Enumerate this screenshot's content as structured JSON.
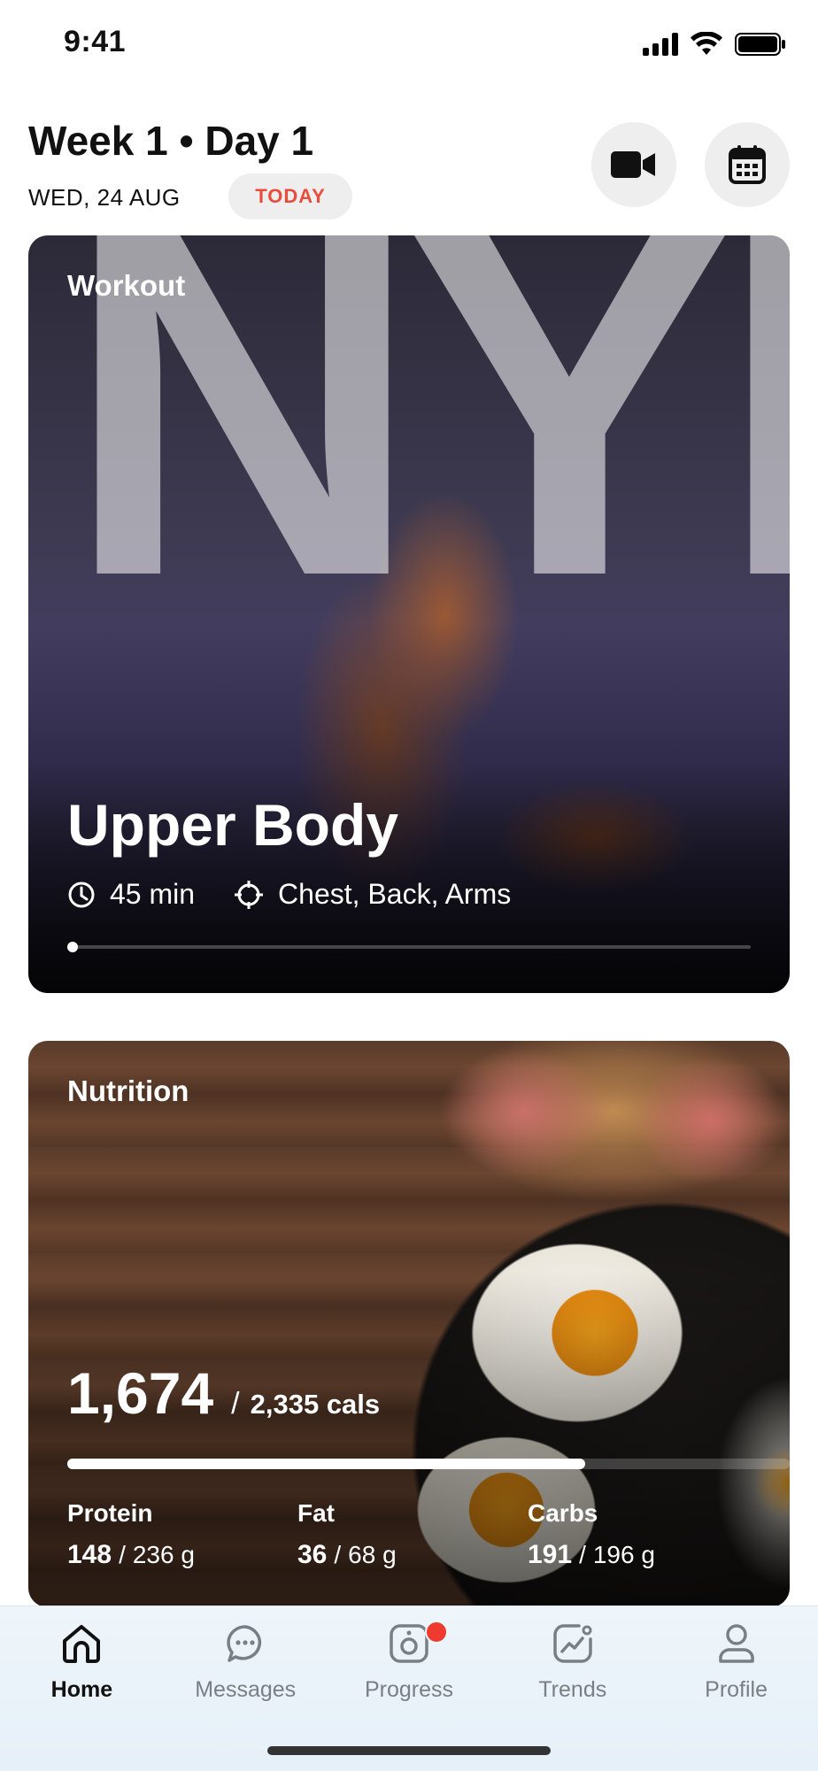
{
  "status_bar": {
    "time": "9:41"
  },
  "header": {
    "title": "Week 1 • Day 1",
    "date": "WED, 24 AUG",
    "badge": "TODAY"
  },
  "workout": {
    "label": "Workout",
    "title": "Upper Body",
    "duration": "45 min",
    "targets": "Chest, Back, Arms",
    "backdrop_text": "NYP"
  },
  "nutrition": {
    "label": "Nutrition",
    "calories_eaten": "1,674",
    "calories_separator": "/",
    "calories_goal": "2,335 cals",
    "calories_progress": 0.717,
    "macros": [
      {
        "name": "Protein",
        "value": "148",
        "goal": "236 g"
      },
      {
        "name": "Fat",
        "value": "36",
        "goal": "68 g"
      },
      {
        "name": "Carbs",
        "value": "191",
        "goal": "196 g"
      }
    ]
  },
  "tabs": [
    {
      "label": "Home",
      "icon": "home-icon",
      "active": true
    },
    {
      "label": "Messages",
      "icon": "messages-icon",
      "active": false
    },
    {
      "label": "Progress",
      "icon": "progress-camera-icon",
      "active": false,
      "badge": true
    },
    {
      "label": "Trends",
      "icon": "trends-icon",
      "active": false
    },
    {
      "label": "Profile",
      "icon": "profile-icon",
      "active": false
    }
  ],
  "colors": {
    "accent": "#ea4b3b",
    "notification": "#ef3b2f",
    "tab_bar": "#eef5fb"
  }
}
